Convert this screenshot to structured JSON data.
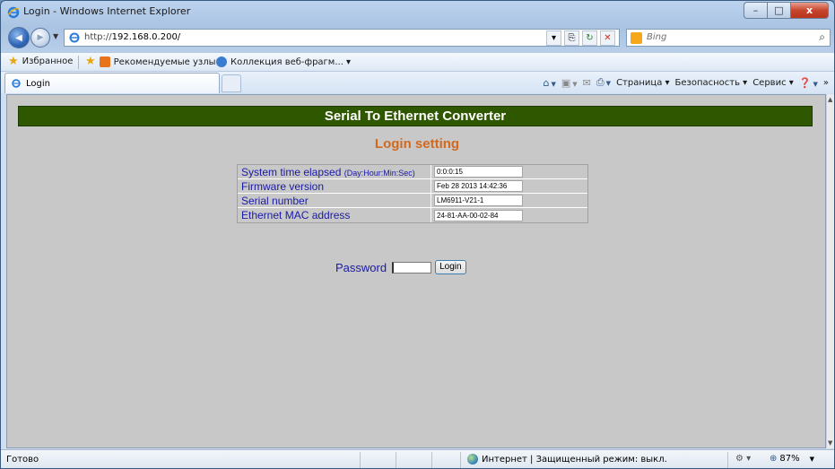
{
  "window": {
    "title": "Login - Windows Internet Explorer",
    "controls": {
      "minimize": "–",
      "maximize": "□",
      "close": "x"
    }
  },
  "nav": {
    "back_icon": "◀",
    "forward_icon": "▶",
    "dropdown": "▼",
    "url_prefix": "http://",
    "url_host": "192.168.0.200/",
    "tools": [
      "▾",
      "⎘",
      "↻",
      "✕"
    ],
    "search_placeholder": "Bing",
    "search_icon": "⌕"
  },
  "favorites": {
    "label": "Избранное",
    "items": [
      "Рекомендуемые узлы ▾",
      "Коллекция веб-фрагм... ▾"
    ]
  },
  "tabs": {
    "active_label": "Login"
  },
  "commands": {
    "items": [
      "Страница ▾",
      "Безопасность ▾",
      "Сервис ▾"
    ],
    "more": "»"
  },
  "page": {
    "banner": "Serial To Ethernet Converter",
    "heading": "Login setting",
    "rows": [
      {
        "label": "System time elapsed",
        "hint": "(Day:Hour:Min:Sec)",
        "value": "0:0:0:15"
      },
      {
        "label": "Firmware version",
        "hint": "",
        "value": "Feb 28 2013 14:42:36"
      },
      {
        "label": "Serial number",
        "hint": "",
        "value": "LM6911-V21-1"
      },
      {
        "label": "Ethernet MAC address",
        "hint": "",
        "value": "24-81-AA-00-02-84"
      }
    ],
    "password_label": "Password",
    "password_value": "",
    "login_button": "Login"
  },
  "status": {
    "text": "Готово",
    "zone": "Интернет | Защищенный режим: выкл.",
    "zoom": "87%",
    "zoom_arrow": "▼",
    "protect_icon": "⚙ ▾"
  },
  "colors": {
    "banner_bg": "#2f5700",
    "heading": "#d2691e",
    "label": "#1a1aa8",
    "page_bg": "#c8c8c8"
  }
}
